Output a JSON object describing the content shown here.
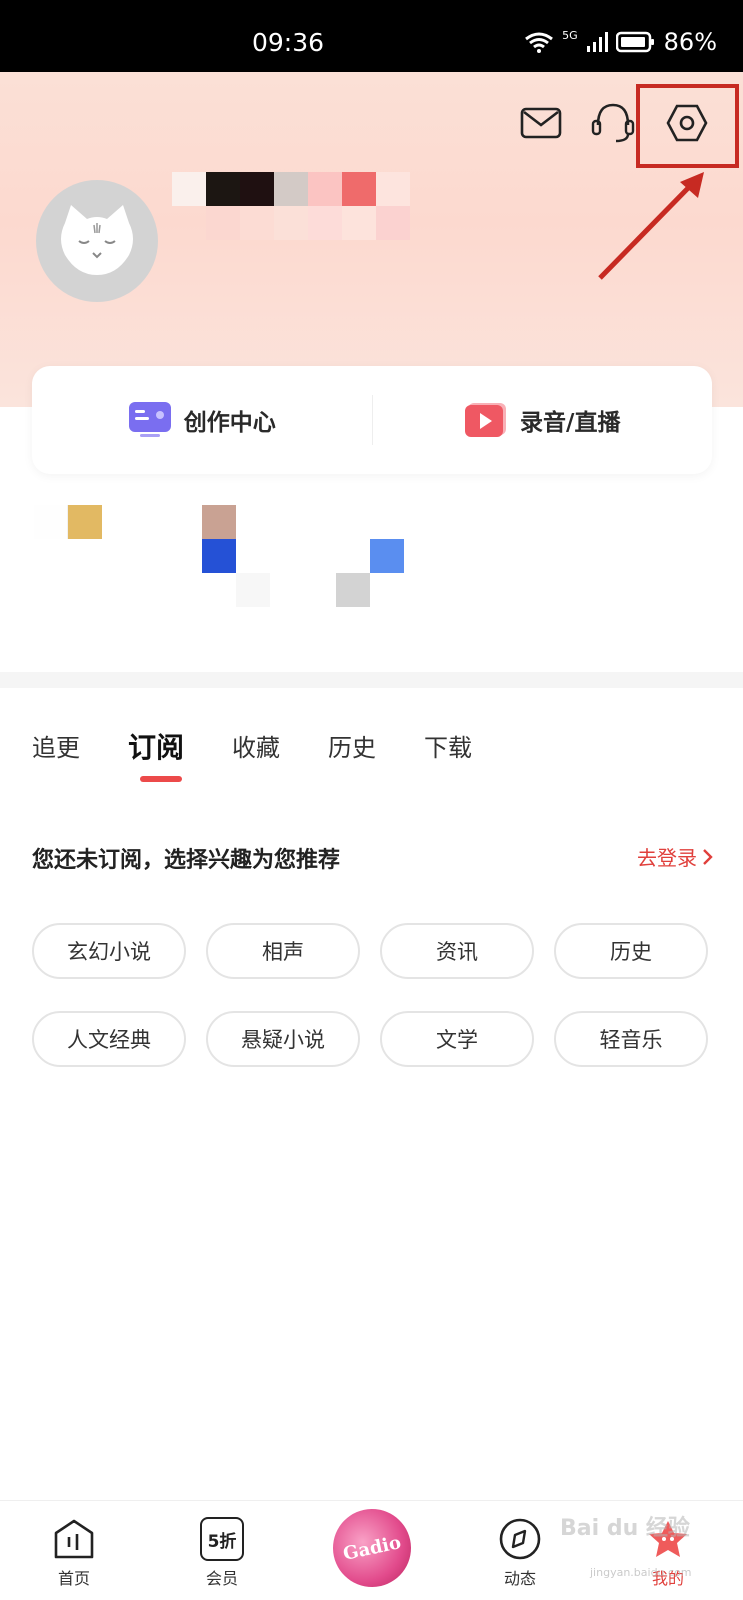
{
  "status_bar": {
    "time": "09:36",
    "network": "5G",
    "battery": "86%"
  },
  "header": {
    "icons": [
      "mail-icon",
      "headset-icon",
      "settings-icon"
    ]
  },
  "creation": {
    "create_center": "创作中心",
    "record_live": "录音/直播"
  },
  "tabs": [
    {
      "label": "追更",
      "active": false
    },
    {
      "label": "订阅",
      "active": true
    },
    {
      "label": "收藏",
      "active": false
    },
    {
      "label": "历史",
      "active": false
    },
    {
      "label": "下载",
      "active": false
    }
  ],
  "subscribe": {
    "empty_text": "您还未订阅，选择兴趣为您推荐",
    "login_link": "去登录"
  },
  "tags": [
    "玄幻小说",
    "相声",
    "资讯",
    "历史",
    "人文经典",
    "悬疑小说",
    "文学",
    "轻音乐"
  ],
  "bottom_nav": {
    "home": "首页",
    "member": "会员",
    "member_icon_text": "5折",
    "center_text": "Gadio",
    "activity": "动态",
    "mine": "我的"
  },
  "watermark": {
    "text": "Bai du 经验",
    "sub": "jingyan.baidu.com"
  },
  "colors": {
    "accent": "#e0403c",
    "header_bg": "#fcd9cf",
    "highlight": "#c72a22"
  }
}
